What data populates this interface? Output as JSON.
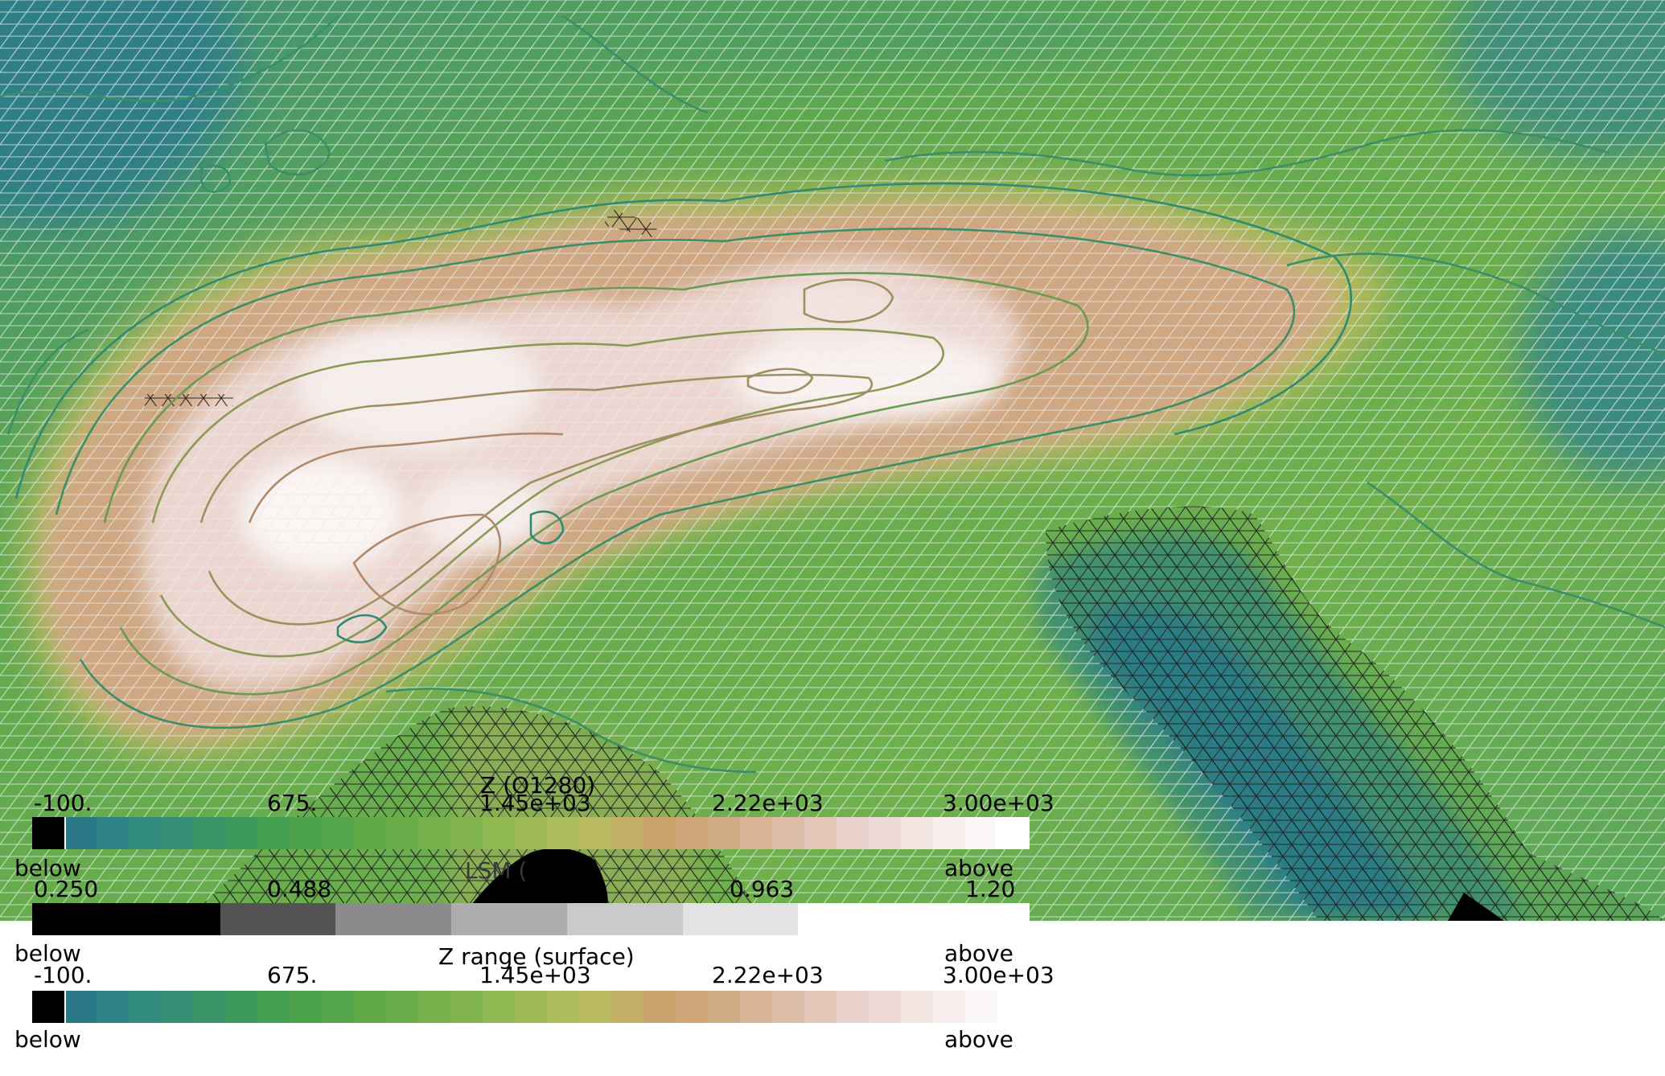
{
  "map": {
    "grid_color_light": "#dfe6e6",
    "grid_color_dark": "#000000",
    "palette": [
      "#000000",
      "#2d7a86",
      "#328a80",
      "#38956c",
      "#3f9c57",
      "#4aa04a",
      "#62a846",
      "#7ab34c",
      "#95bb55",
      "#b3bc5e",
      "#c7ad68",
      "#cfa57a",
      "#d8b096",
      "#e2c4b4",
      "#eed8d2",
      "#f7ecea",
      "#ffffff"
    ],
    "lsm_palette": [
      "#000000",
      "#555555",
      "#8e8e8e",
      "#b0b0b0",
      "#cdcdcd",
      "#e2e2e2",
      "#ffffff"
    ]
  },
  "colorbar_z_o1280": {
    "title": "Z (O1280)",
    "ticks": [
      "-100.",
      "675.",
      "1.45e+03",
      "2.22e+03",
      "3.00e+03"
    ],
    "below_label": "below",
    "above_label": "above",
    "colors": [
      "#000000",
      "#2a7886",
      "#2d8286",
      "#318a7e",
      "#368f74",
      "#3a9468",
      "#3e995c",
      "#43a052",
      "#4ba24b",
      "#55a54a",
      "#61a947",
      "#6aac49",
      "#76b14c",
      "#82b54f",
      "#8fb852",
      "#9eba57",
      "#adbc5c",
      "#b9b95f",
      "#c2ae65",
      "#c8a46c",
      "#cda578",
      "#d2ab87",
      "#d8b596",
      "#dcbca6",
      "#e2c6b8",
      "#e8d1ca",
      "#eedad6",
      "#f2e4e1",
      "#f7edec",
      "#fbf6f6",
      "#ffffff"
    ]
  },
  "colorbar_lsm": {
    "title": "LSM (",
    "ticks": [
      "0.250",
      "0.488",
      "0.963",
      "1.20"
    ],
    "below_label": "below",
    "above_label": "above",
    "colors": [
      "#000000",
      "#000000",
      "#535353",
      "#8b8b8b",
      "#adadad",
      "#cacaca",
      "#e3e3e3",
      "#ffffff",
      "#ffffff"
    ]
  },
  "colorbar_z_surface": {
    "title": "Z range (surface)",
    "ticks": [
      "-100.",
      "675.",
      "1.45e+03",
      "2.22e+03",
      "3.00e+03"
    ],
    "below_label": "below",
    "above_label": "above",
    "colors": [
      "#000000",
      "#2a7886",
      "#2d8286",
      "#318a7e",
      "#368f74",
      "#3a9468",
      "#3e995c",
      "#43a052",
      "#4ba24b",
      "#55a54a",
      "#61a947",
      "#6aac49",
      "#76b14c",
      "#82b54f",
      "#8fb852",
      "#9eba57",
      "#adbc5c",
      "#b9b95f",
      "#c2ae65",
      "#c8a46c",
      "#cda578",
      "#d2ab87",
      "#d8b596",
      "#dcbca6",
      "#e2c6b8",
      "#e8d1ca",
      "#eedad6",
      "#f2e4e1",
      "#f7edec",
      "#fbf6f6"
    ]
  }
}
